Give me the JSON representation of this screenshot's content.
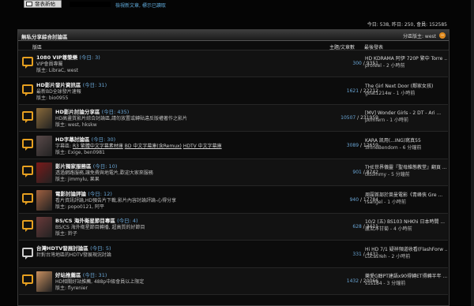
{
  "topbar": {
    "post_button": "發表新帖",
    "mark_read": "檢視新文章, 標示已讀取",
    "stats": "今日: 538, 昨日: 250, 會員: 152585"
  },
  "panel": {
    "title": "無私分享綜合討論區",
    "moderator": "分區版主: west",
    "collapse_icon": "−",
    "columns": {
      "forum": "版區",
      "topics": "主題/文章數",
      "last": "最後發表"
    }
  },
  "forums": [
    {
      "name": "1080 VIP尊榮樂",
      "today": "(今日: 3)",
      "desc": "VIP會員專屬",
      "mods": "版主: LibraC, west",
      "topics": "300",
      "posts": "9351",
      "last_title": "HD KDRAMA 阿伊 720P 繁中 Torre ...",
      "last_info": "profeel - 2 小時前",
      "icon": "bubble-orange",
      "thumb": null
    },
    {
      "name": "HD影片發片資訊區",
      "today": "(今日: 31)",
      "desc": "最新BD全球發片速報",
      "mods": "版主: bio0955",
      "topics": "1621",
      "posts": "22212",
      "last_title": "The Girl Next Door (鄰家女孩)",
      "last_info": "goat1214w - 1 小時前",
      "icon": "bubble-orange",
      "thumb": null
    },
    {
      "name": "HD影片討論分享區",
      "today": "(今日: 435)",
      "desc": "HD高畫質影片綜合討論區,請勿放置或轉貼違反版權著作之影片",
      "mods": "版主: west, hkskw",
      "topics": "10507",
      "posts": "231959",
      "last_title": "[MV] Wonder Girls - 2 DT - Ari ...",
      "last_info": "pomfern - 1 小時前",
      "icon": "bubble-orange",
      "thumb": "#8a6a3a"
    },
    {
      "name": "HD字幕討論區",
      "today": "(今日: 30)",
      "tags": [
        "字幕區:",
        "R3 繁體中文字幕素材庫",
        "BD 中文字幕庫(含Remux)",
        "HDTV 中文字幕庫"
      ],
      "mods": "版主: Exige, ben0981",
      "topics": "3089",
      "posts": "12659",
      "last_title": "KARA 凯用(...ING)寫真55",
      "last_info": "ShineBendom - 6 分鐘前",
      "icon": "bubble-orange",
      "thumb": "#5a4a4a"
    },
    {
      "name": "影片獨家服務區",
      "today": "(今日: 10)",
      "desc": "透過網路服務,讓免費與地電片,歡迎大家來服務",
      "mods": "版主: jimmylu, 果果",
      "topics": "901",
      "posts": "8742",
      "last_title": "THE世界儀靈『聖母維態教堂』翻頁 ...",
      "last_info": "tktommy - 5 分鐘前",
      "icon": "bubble-orange",
      "thumb": "#7a1a1a"
    },
    {
      "name": "電影討論評論",
      "today": "(今日: 12)",
      "desc": "看片資訊評論,HD預告片下載,影片內容討論評論-心得分享",
      "mods": "版主: popo0121, 阿平",
      "topics": "940",
      "posts": "17784",
      "last_title": "周圍首部於萊曼電影《青峰俠 Gre ...",
      "last_info": "rsangel - 1 小時前",
      "icon": "bubble-orange",
      "thumb": "#a06040"
    },
    {
      "name": "BS/CS 海外衛星節目專區",
      "today": "(今日: 4)",
      "desc": "BS/CS 海外衛星節目轉播, 超高質的好節目",
      "mods": "版主: 鈴子",
      "topics": "628",
      "posts": "3411",
      "last_title": "10/2 (五) BS103 NHKhi 日本時間 ...",
      "last_info": "蘆瓜洋甘菊 - 4 小時前",
      "icon": "bubble-orange",
      "thumb": "#6a3a3a"
    },
    {
      "name": "台灣HDTV發展討論區",
      "today": "(今日: 5)",
      "desc": "針對台灣地區的HDTV發展現況討論",
      "mods": "",
      "topics": "331",
      "posts": "4431",
      "last_title": "Hi HD 7/1 疑祥頻道收看(FlashForw ...",
      "last_info": "LucasYeh - 2 小時前",
      "icon": "bubble-grey",
      "thumb": null
    },
    {
      "name": "好站推薦區",
      "today": "(今日: 31)",
      "desc": "HD相關好站推薦, 488p中級會員以上限定",
      "mods": "版主: flyrenier",
      "topics": "1432",
      "posts": "20066",
      "last_title": "樂愛G醇PT建語x90得轉ET得轉半年 ...",
      "last_info": "s1s184 - 3 分鐘前",
      "icon": "bubble-orange",
      "thumb": "#c89060"
    }
  ]
}
